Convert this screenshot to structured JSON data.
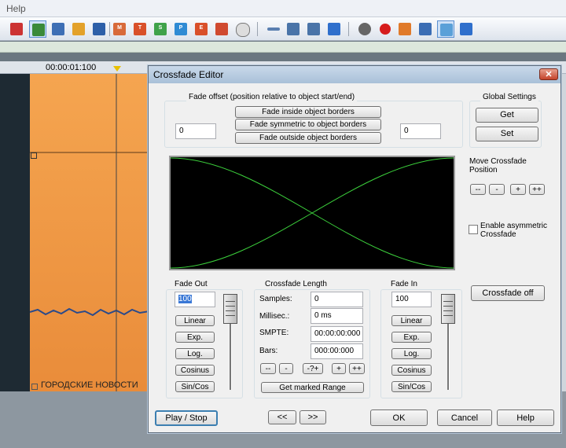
{
  "menubar": {
    "help": "Help"
  },
  "ruler": {
    "time": "00:00:01:100"
  },
  "track": {
    "label": "ГОРОДСКИЕ НОВОСТИ"
  },
  "dialog": {
    "title": "Crossfade Editor",
    "close": "✕",
    "fade_offset": {
      "label": "Fade offset  (position relative to object start/end)",
      "left_value": "0",
      "right_value": "0",
      "buttons": [
        "Fade inside object borders",
        "Fade symmetric to object borders",
        "Fade outside object borders"
      ]
    },
    "global_settings": {
      "label": "Global Settings",
      "get": "Get",
      "set": "Set"
    },
    "move": {
      "label": "Move Crossfade Position",
      "buttons": [
        "--",
        "-",
        "+",
        "++"
      ]
    },
    "asymmetric": {
      "label": "Enable asymmetric Crossfade",
      "checked": false
    },
    "crossfade_off": "Crossfade off",
    "fade_out": {
      "label": "Fade Out",
      "value": "100",
      "curves": [
        "Linear",
        "Exp.",
        "Log.",
        "Cosinus",
        "Sin/Cos"
      ]
    },
    "fade_in": {
      "label": "Fade In",
      "value": "100",
      "curves": [
        "Linear",
        "Exp.",
        "Log.",
        "Cosinus",
        "Sin/Cos"
      ]
    },
    "length": {
      "label": "Crossfade Length",
      "samples_label": "Samples:",
      "samples": "0",
      "ms_label": "Millisec.:",
      "ms": "0 ms",
      "smpte_label": "SMPTE:",
      "smpte": "00:00:00:000",
      "bars_label": "Bars:",
      "bars": "000:00:000",
      "step_buttons": [
        "--",
        "-",
        "-?+",
        "+",
        "++"
      ],
      "get_marked": "Get marked Range"
    },
    "footer": {
      "play_stop": "Play / Stop",
      "prev": "<<",
      "next": ">>",
      "ok": "OK",
      "cancel": "Cancel",
      "help": "Help"
    }
  },
  "colors": {
    "curve": "#3cd13c",
    "track": "#f0a050",
    "accent": "#5a8fd0"
  }
}
